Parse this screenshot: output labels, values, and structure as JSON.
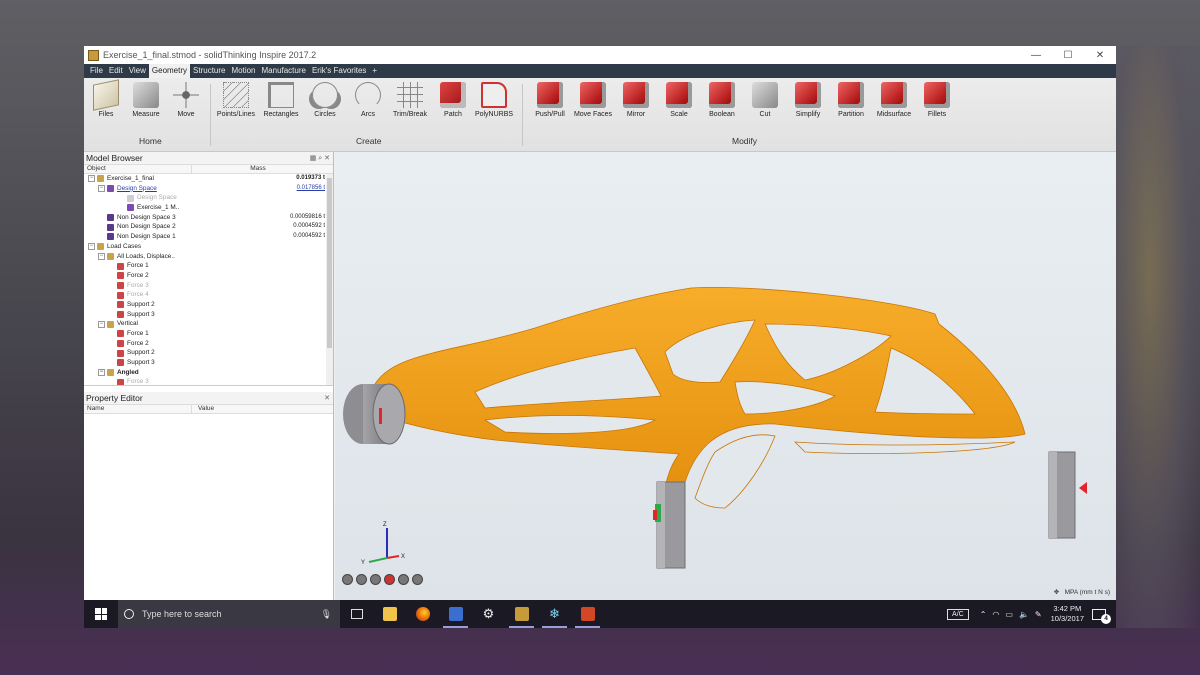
{
  "window": {
    "title": "Exercise_1_final.stmod - solidThinking Inspire 2017.2",
    "controls": [
      "—",
      "☐",
      "✕"
    ]
  },
  "menu": [
    "File",
    "Edit",
    "View",
    "Geometry",
    "Structure",
    "Motion",
    "Manufacture",
    "Erik's Favorites",
    "+"
  ],
  "active_menu": "Geometry",
  "ribbon": {
    "groups": [
      {
        "label": "Home",
        "tools": [
          "Files",
          "Measure",
          "Move"
        ]
      },
      {
        "label": "Create",
        "tools": [
          "Points/Lines",
          "Rectangles",
          "Circles",
          "Arcs",
          "Trim/Break",
          "Patch",
          "PolyNURBS"
        ]
      },
      {
        "label": "Modify",
        "tools": [
          "Push/Pull",
          "Move Faces",
          "Mirror",
          "Scale",
          "Boolean",
          "Cut",
          "Simplify",
          "Partition",
          "Midsurface",
          "Fillets"
        ]
      }
    ]
  },
  "model_browser": {
    "title": "Model Browser",
    "columns": [
      "Object",
      "Mass"
    ],
    "rows": [
      {
        "name": "Exercise_1_final",
        "mass": "0.019373 t",
        "indent": 0,
        "expander": "−",
        "icon": "folder",
        "style": "bold-mass"
      },
      {
        "name": "Design Space",
        "mass": "0.017856 t",
        "indent": 1,
        "expander": "−",
        "icon": "design",
        "style": "link"
      },
      {
        "name": "Design Space",
        "mass": "",
        "indent": 3,
        "expander": "",
        "icon": "ghost",
        "style": "dim"
      },
      {
        "name": "Exercise_1 M..",
        "mass": "",
        "indent": 3,
        "expander": "",
        "icon": "part",
        "style": ""
      },
      {
        "name": "Non Design Space 3",
        "mass": "0.00059816 t",
        "indent": 1,
        "expander": "",
        "icon": "nds",
        "style": ""
      },
      {
        "name": "Non Design Space 2",
        "mass": "0.0004592 t",
        "indent": 1,
        "expander": "",
        "icon": "nds",
        "style": ""
      },
      {
        "name": "Non Design Space 1",
        "mass": "0.0004592 t",
        "indent": 1,
        "expander": "",
        "icon": "nds",
        "style": ""
      },
      {
        "name": "Load Cases",
        "mass": "",
        "indent": 0,
        "expander": "−",
        "icon": "folder",
        "style": ""
      },
      {
        "name": "All Loads, Displace..",
        "mass": "",
        "indent": 1,
        "expander": "−",
        "icon": "folder",
        "style": ""
      },
      {
        "name": "Force 1",
        "mass": "",
        "indent": 2,
        "expander": "",
        "icon": "force",
        "style": ""
      },
      {
        "name": "Force 2",
        "mass": "",
        "indent": 2,
        "expander": "",
        "icon": "force",
        "style": ""
      },
      {
        "name": "Force 3",
        "mass": "",
        "indent": 2,
        "expander": "",
        "icon": "force",
        "style": "dim"
      },
      {
        "name": "Force 4",
        "mass": "",
        "indent": 2,
        "expander": "",
        "icon": "force",
        "style": "dim"
      },
      {
        "name": "Support 2",
        "mass": "",
        "indent": 2,
        "expander": "",
        "icon": "support",
        "style": ""
      },
      {
        "name": "Support 3",
        "mass": "",
        "indent": 2,
        "expander": "",
        "icon": "support",
        "style": ""
      },
      {
        "name": "Vertical",
        "mass": "",
        "indent": 1,
        "expander": "−",
        "icon": "folder",
        "style": ""
      },
      {
        "name": "Force 1",
        "mass": "",
        "indent": 2,
        "expander": "",
        "icon": "force",
        "style": ""
      },
      {
        "name": "Force 2",
        "mass": "",
        "indent": 2,
        "expander": "",
        "icon": "force",
        "style": ""
      },
      {
        "name": "Support 2",
        "mass": "",
        "indent": 2,
        "expander": "",
        "icon": "support",
        "style": ""
      },
      {
        "name": "Support 3",
        "mass": "",
        "indent": 2,
        "expander": "",
        "icon": "support",
        "style": ""
      },
      {
        "name": "Angled",
        "mass": "",
        "indent": 1,
        "expander": "−",
        "icon": "folder",
        "style": "bold"
      },
      {
        "name": "Force 3",
        "mass": "",
        "indent": 2,
        "expander": "",
        "icon": "force",
        "style": "dim"
      }
    ]
  },
  "property_editor": {
    "title": "Property Editor",
    "columns": [
      "Name",
      "Value"
    ]
  },
  "viewport": {
    "axis": {
      "z": "Z",
      "y": "Y",
      "x": "X"
    },
    "units": "MPA (mm t N s)"
  },
  "taskbar": {
    "search_placeholder": "Type here to search",
    "apps": [
      "task-view",
      "file-explorer",
      "firefox",
      "save",
      "settings",
      "inspire",
      "snowflake",
      "powerpoint"
    ],
    "keyboard_layout": "A/C",
    "time": "3:42 PM",
    "date": "10/3/2017",
    "notifications": "4"
  },
  "colors": {
    "part_orange": "#f29a12",
    "menu_bar": "#2f3a48",
    "taskbar": "#1b1a24",
    "support_gray": "#8f8f93",
    "load_red": "#e0262a"
  }
}
